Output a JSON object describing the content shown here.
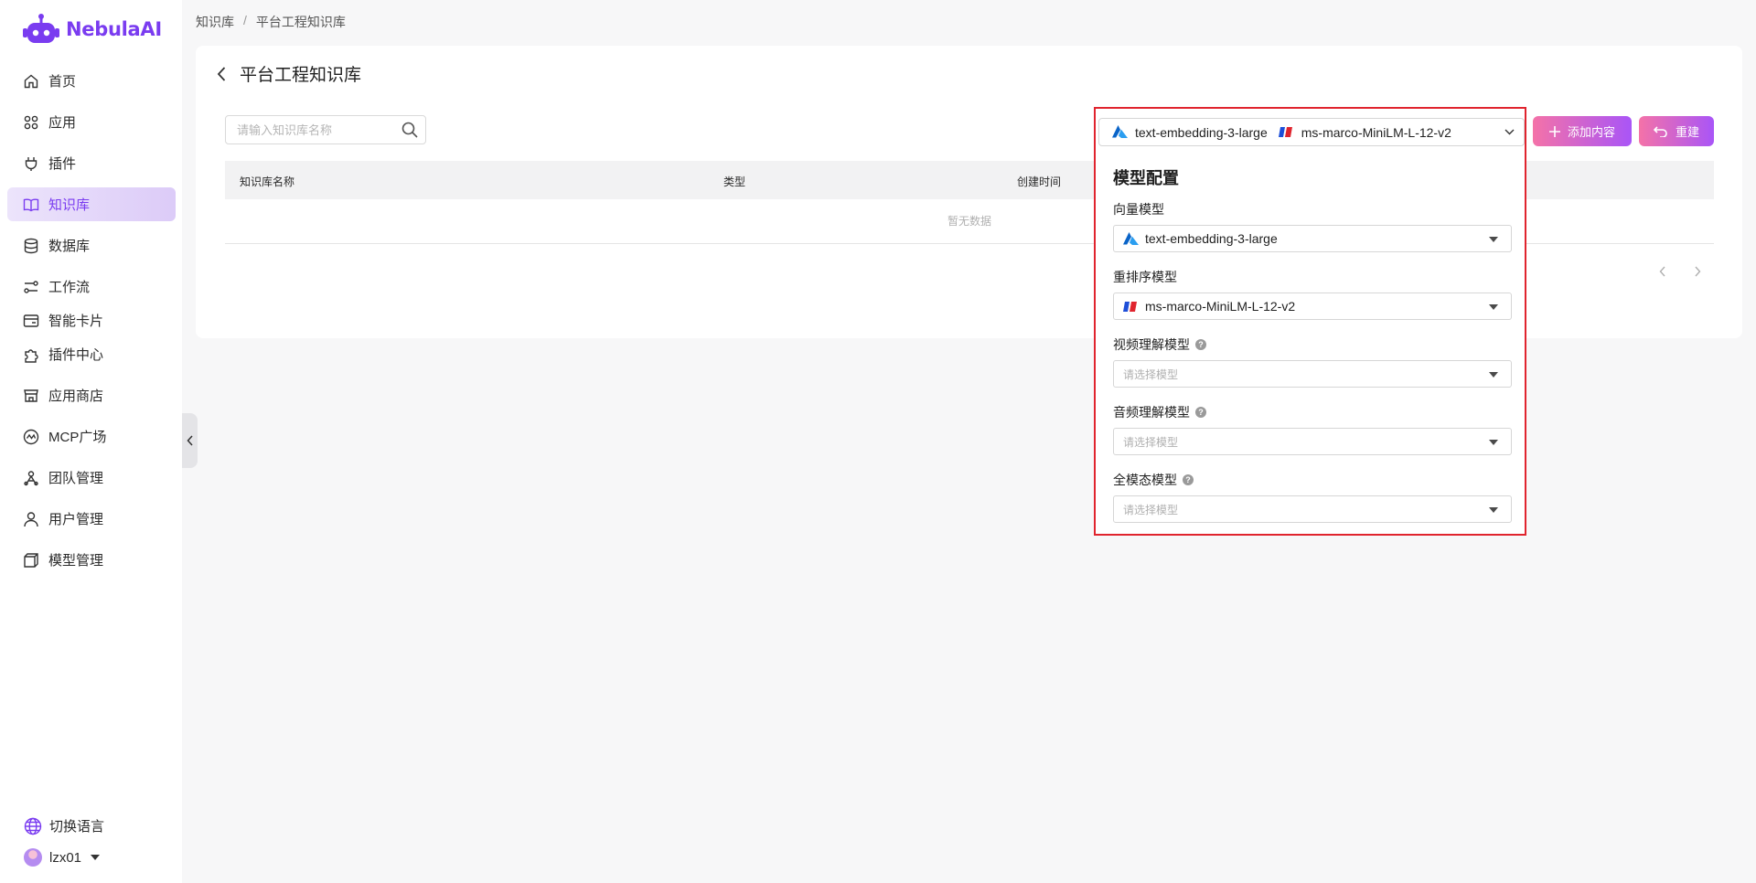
{
  "app": {
    "name": "NebulaAI"
  },
  "sidebar": {
    "items": [
      {
        "label": "首页",
        "icon": "home-icon"
      },
      {
        "label": "应用",
        "icon": "apps-icon"
      },
      {
        "label": "插件",
        "icon": "plug-icon"
      },
      {
        "label": "知识库",
        "icon": "book-icon",
        "active": true
      },
      {
        "label": "数据库",
        "icon": "database-icon"
      },
      {
        "label": "工作流",
        "icon": "workflow-icon"
      },
      {
        "label": "智能卡片",
        "icon": "card-icon"
      },
      {
        "label": "插件中心",
        "icon": "puzzle-icon"
      },
      {
        "label": "应用商店",
        "icon": "store-icon"
      },
      {
        "label": "MCP广场",
        "icon": "mcp-icon"
      },
      {
        "label": "团队管理",
        "icon": "team-icon"
      },
      {
        "label": "用户管理",
        "icon": "user-icon"
      },
      {
        "label": "模型管理",
        "icon": "cube-icon"
      }
    ],
    "language": "切换语言",
    "username": "lzx01"
  },
  "breadcrumb": {
    "root": "知识库",
    "separator": "/",
    "current": "平台工程知识库"
  },
  "page": {
    "title": "平台工程知识库",
    "search_placeholder": "请输入知识库名称",
    "add_button": "添加内容",
    "rebuild_button": "重建",
    "table": {
      "columns": [
        "知识库名称",
        "类型",
        "创建时间"
      ],
      "empty_text": "暂无数据"
    }
  },
  "model_config": {
    "trigger": {
      "embedding": "text-embedding-3-large",
      "rerank": "ms-marco-MiniLM-L-12-v2"
    },
    "title": "模型配置",
    "fields": [
      {
        "label": "向量模型",
        "value": "text-embedding-3-large",
        "help": false
      },
      {
        "label": "重排序模型",
        "value": "ms-marco-MiniLM-L-12-v2",
        "help": false
      },
      {
        "label": "视频理解模型",
        "placeholder": "请选择模型",
        "help": true
      },
      {
        "label": "音频理解模型",
        "placeholder": "请选择模型",
        "help": true
      },
      {
        "label": "全模态模型",
        "placeholder": "请选择模型",
        "help": true
      }
    ]
  },
  "colors": {
    "brand": "#7a3cf0",
    "highlight": "#e0242e",
    "button_gradient_start": "#f472a8",
    "button_gradient_end": "#a955f7"
  }
}
